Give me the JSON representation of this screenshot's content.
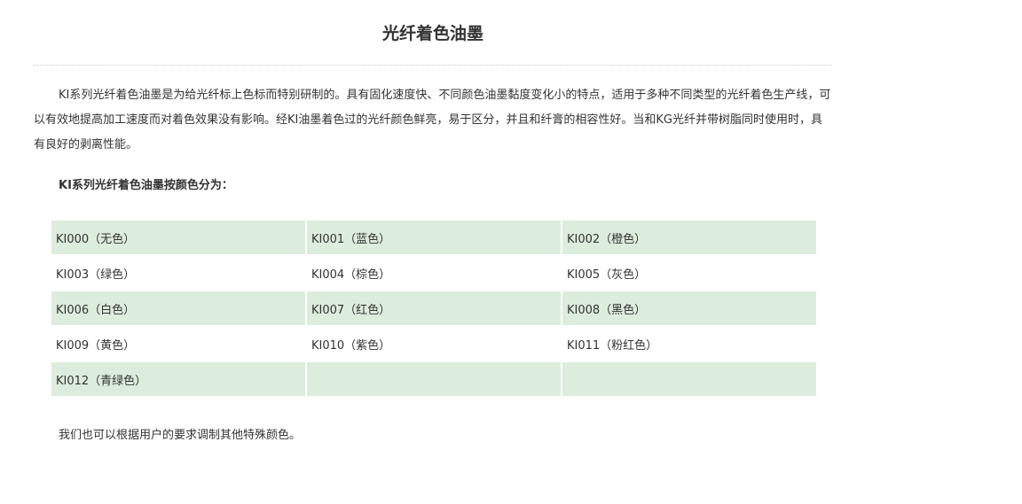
{
  "article": {
    "title": "光纤着色油墨",
    "intro": "KI系列光纤着色油墨是为给光纤标上色标而特别研制的。具有固化速度快、不同颜色油墨黏度变化小的特点，适用于多种不同类型的光纤着色生产线，可以有效地提高加工速度而对着色效果没有影响。经KI油墨着色过的光纤颜色鲜亮，易于区分，并且和纤膏的相容性好。当和KG光纤并带树脂同时使用时，具有良好的剥离性能。",
    "subheading": "KI系列光纤着色油墨按颜色分为：",
    "color_table": {
      "rows": [
        [
          "KI000（无色）",
          "KI001（蓝色）",
          "KI002（橙色）"
        ],
        [
          "KI003（绿色）",
          "KI004（棕色）",
          "KI005（灰色）"
        ],
        [
          "KI006（白色）",
          "KI007（红色）",
          "KI008（黑色）"
        ],
        [
          "KI009（黄色）",
          "KI010（紫色）",
          "KI011（粉红色）"
        ],
        [
          "KI012（青绿色）",
          "",
          ""
        ]
      ],
      "shaded_row_color": "#dcecdd"
    },
    "footer_note": "我们也可以根据用户的要求调制其他特殊颜色。"
  }
}
